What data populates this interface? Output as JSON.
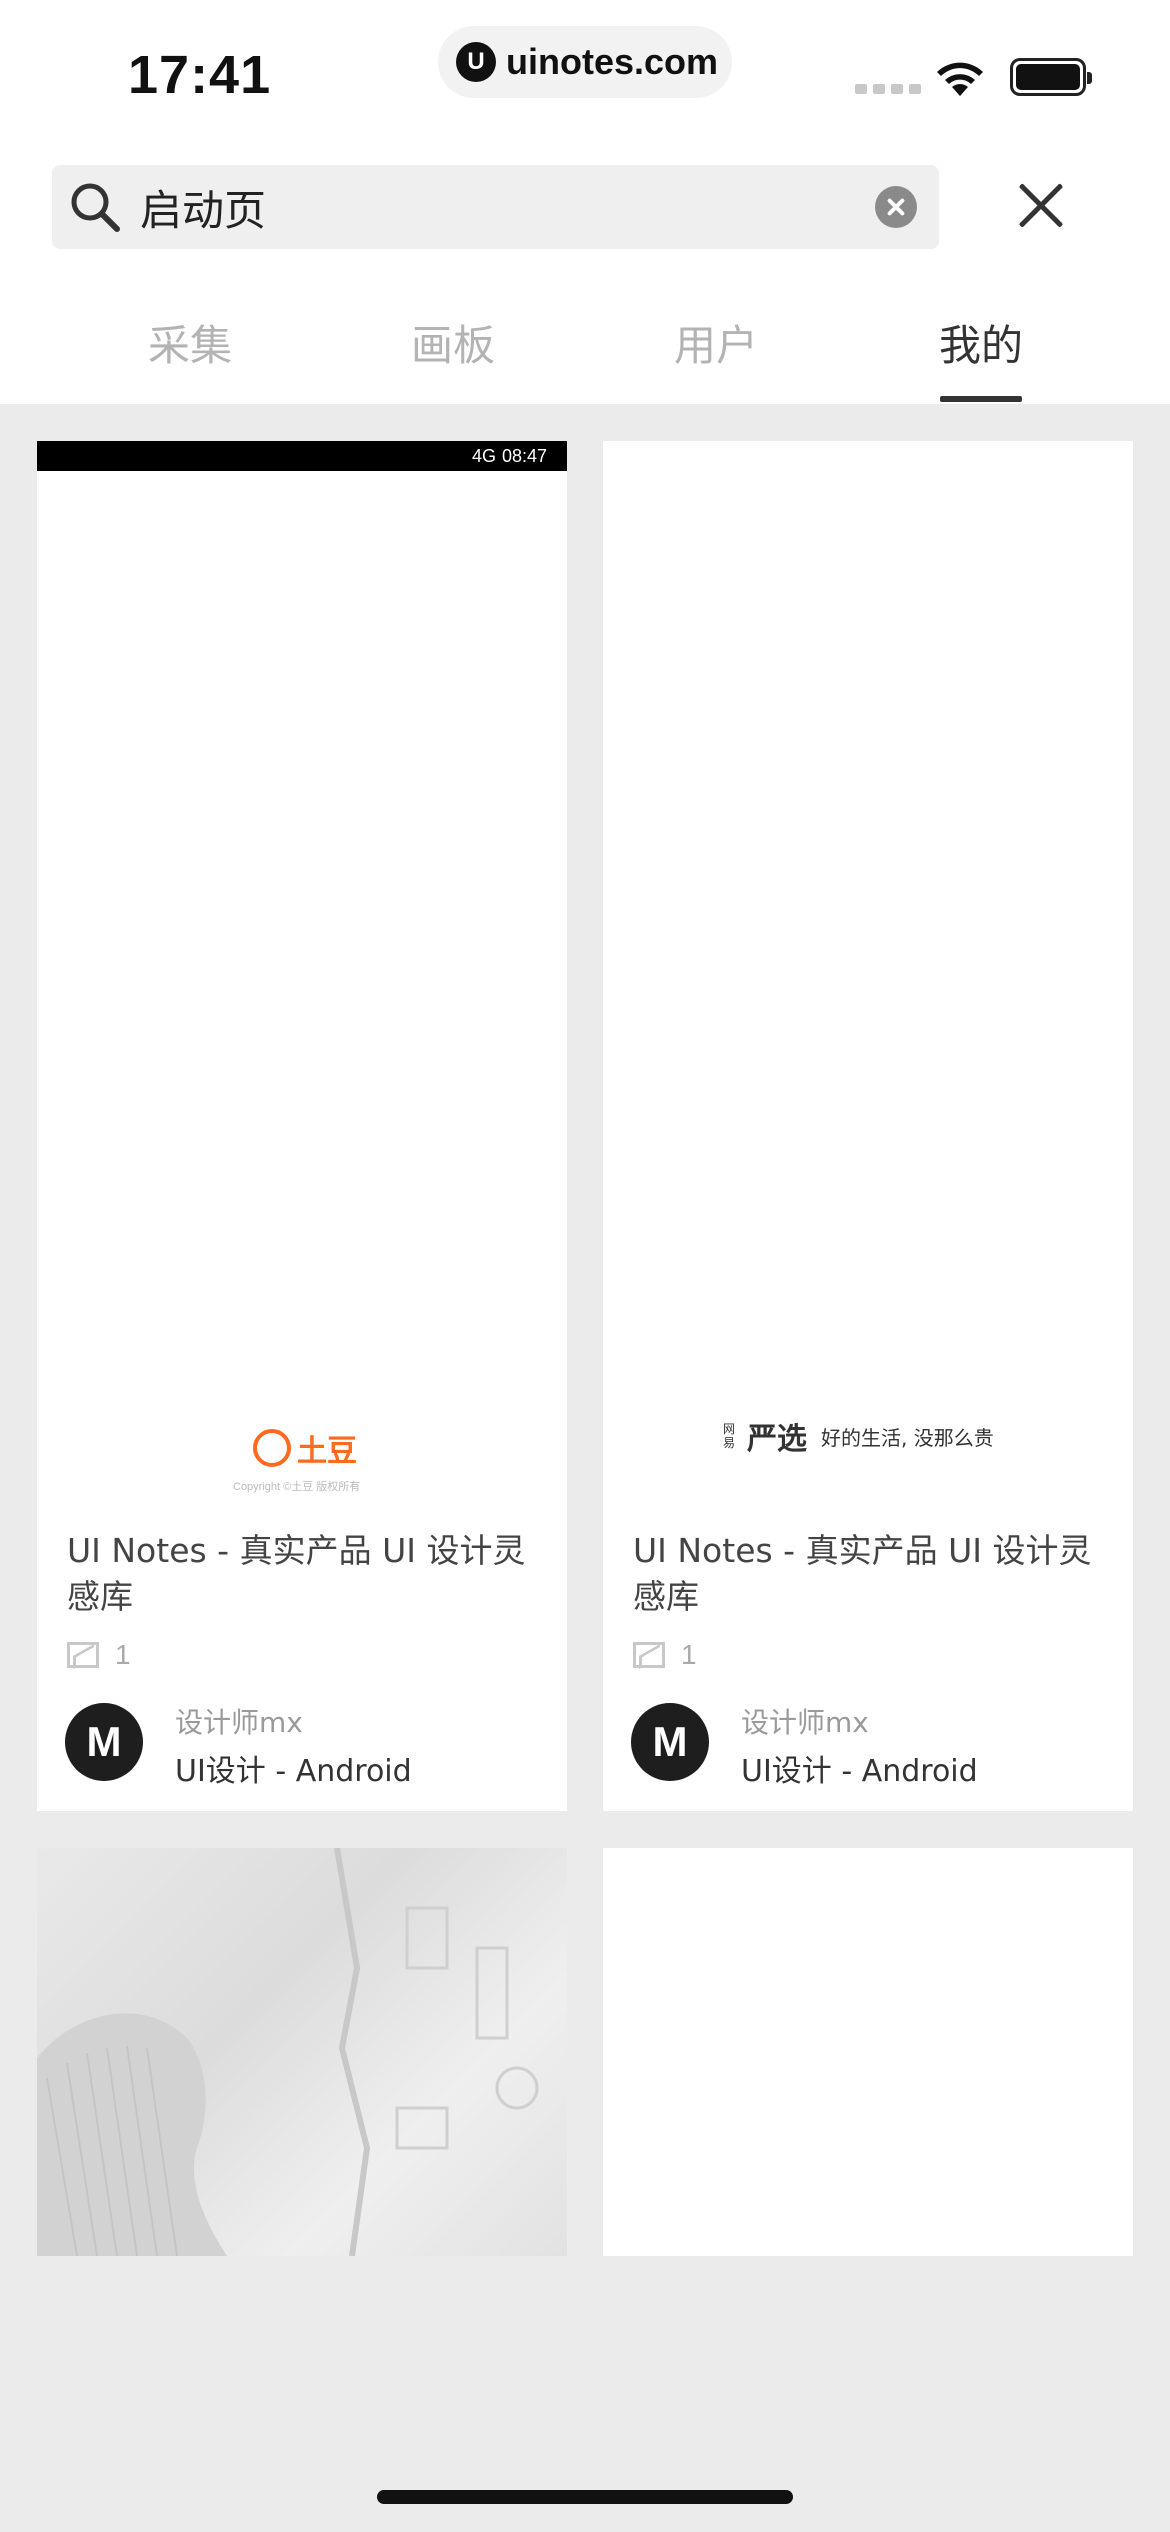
{
  "status_bar": {
    "time": "17:41",
    "url": "uinotes.com",
    "url_logo": "U"
  },
  "search": {
    "query": "启动页"
  },
  "tabs": [
    {
      "label": "采集"
    },
    {
      "label": "画板"
    },
    {
      "label": "用户"
    },
    {
      "label": "我的",
      "active": true
    }
  ],
  "cards": [
    {
      "screenshot": {
        "android_time": "08:47",
        "network": "4G",
        "brand": "土豆",
        "copyright": "Copyright ©土豆 版权所有"
      },
      "title": "UI Notes - 真实产品 UI 设计灵感库",
      "count": "1",
      "avatar_letter": "M",
      "author": "设计师mx",
      "board": "UI设计 - Android"
    },
    {
      "screenshot": {
        "brand_small": "网易",
        "brand": "严选",
        "slogan": "好的生活, 没那么贵"
      },
      "title": "UI Notes - 真实产品 UI 设计灵感库",
      "count": "1",
      "avatar_letter": "M",
      "author": "设计师mx",
      "board": "UI设计 - Android"
    }
  ],
  "colors": {
    "accent_tudou": "#ff6a1f",
    "background": "#ebebeb",
    "tab_active": "#333333",
    "tab_inactive": "#b3b3b3"
  },
  "icons": [
    "search-icon",
    "clear-icon",
    "close-icon",
    "wifi-icon",
    "battery-icon",
    "image-count-icon"
  ]
}
